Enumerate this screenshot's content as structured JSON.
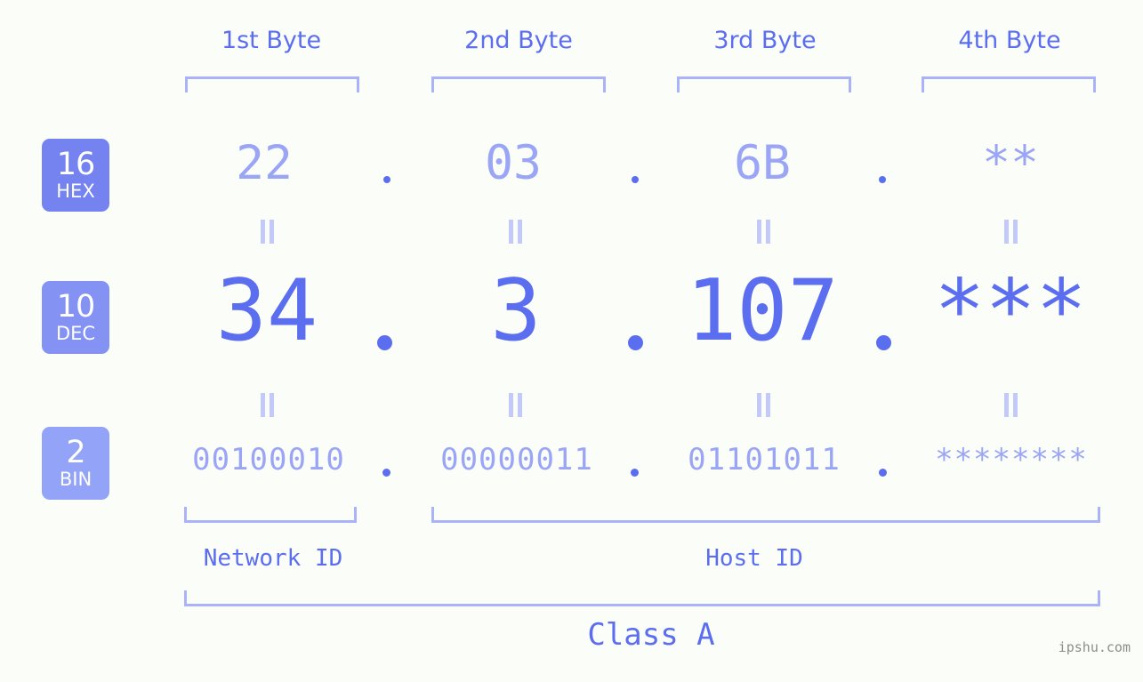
{
  "page": {
    "background": "#fbfdf8",
    "accent": "#5b6ef0",
    "accent_light": "#9aa6f5",
    "bracket_color": "#aab3f7",
    "watermark": "ipshu.com"
  },
  "byte_headers": [
    {
      "label": "1st Byte"
    },
    {
      "label": "2nd Byte"
    },
    {
      "label": "3rd Byte"
    },
    {
      "label": "4th Byte"
    }
  ],
  "bases": [
    {
      "number": "16",
      "name": "HEX",
      "color": "#7583f0"
    },
    {
      "number": "10",
      "name": "DEC",
      "color": "#8492f3"
    },
    {
      "number": "2",
      "name": "BIN",
      "color": "#93a3f7"
    }
  ],
  "rows": {
    "hex": {
      "values": [
        "22",
        "03",
        "6B",
        "**"
      ]
    },
    "dec": {
      "values": [
        "34",
        "3",
        "107",
        "***"
      ]
    },
    "bin": {
      "values": [
        "00100010",
        "00000011",
        "01101011",
        "********"
      ]
    }
  },
  "separators": {
    "dot": ".",
    "equals": "||"
  },
  "segments": [
    {
      "label": "Network ID"
    },
    {
      "label": "Host ID"
    }
  ],
  "class": {
    "label": "Class A"
  }
}
